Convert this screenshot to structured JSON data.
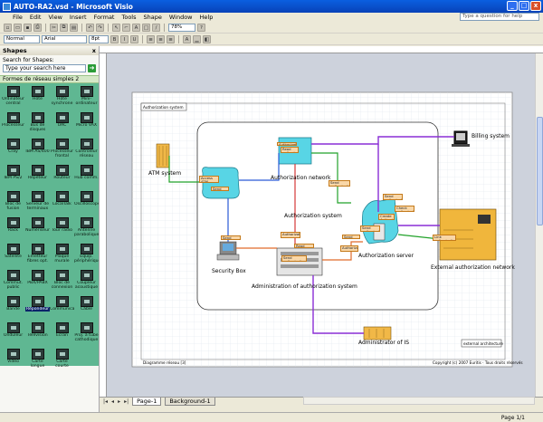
{
  "window": {
    "title": "AUTO-RA2.vsd - Microsoft Visio",
    "buttons": {
      "min": "_",
      "max": "□",
      "close": "x"
    }
  },
  "menu": [
    "File",
    "Edit",
    "View",
    "Insert",
    "Format",
    "Tools",
    "Shape",
    "Window",
    "Help"
  ],
  "help_box": {
    "placeholder": "Type a question for help"
  },
  "toolbar": {
    "zoom": "78%",
    "font": "Arial",
    "size": "8pt",
    "normal": "Normal"
  },
  "shapes_panel": {
    "title": "Shapes",
    "search_label": "Search for Shapes:",
    "search_placeholder": "Type your search here",
    "stencil_title": "Formes de réseau simples 2",
    "items": [
      "Ordinateur central",
      "Hôte",
      "Hôte synchrone",
      "Mini-ordinateur",
      "Processeur",
      "Bus de disques",
      "UAC",
      "Micro VAX",
      "Cray",
      "IBM AS/400",
      "Processeur frontal",
      "Contrôleur réseau",
      "IBM PS/2",
      "Répéteur",
      "Routeur",
      "Hub comm.",
      "Bloc de fusion",
      "Serveur de terminaux",
      "LocalTalk",
      "Oscilloscope",
      "Rack",
      "Numériseur",
      "Tour radio",
      "Antenne parabolique",
      "Satellite",
      "Emetteur fibres opt.",
      "Plaque murale",
      "Equip. périphérique",
      "Commut. public",
      "PBX/PABX",
      "Bloc de connexion",
      "Coupleur acoustique",
      "Bande",
      "Répondeur",
      "Communicateur",
      "Câble",
      "Onduleur",
      "Télévision",
      "Ecran",
      "Proj. à tube cathodique",
      "Vidéo",
      "Carte longue",
      "Carte courte",
      ""
    ]
  },
  "diagram": {
    "page_title": "Authorization system",
    "labels": {
      "atm": "ATM system",
      "billing": "Billing system",
      "auth_network": "Authorization network",
      "auth_system": "Authorization system",
      "auth_server": "Authorization server",
      "security_box": "Security Box",
      "admin": "Administration of authorization system",
      "ext_network": "External authorization network",
      "admin_is": "Administrator of IS",
      "legend": "external architecture",
      "footer_left": "Diagramme réseau [3]",
      "footer_right": "Copyright (c) 2007 Euritis · Tous droits réservés"
    },
    "boxes": [
      "Access ATM authorization",
      "Send Authorization",
      "Read authorization",
      "Send authorization",
      "Send authorization",
      "Check authorization",
      "Send authorization",
      "Authorization server",
      "Send authorization",
      "Authorization server",
      "Link authorization",
      "Send authorization",
      "Read authorization",
      "Create Authorization",
      "Send Authorization",
      "Authorization request"
    ]
  },
  "tabs": {
    "page1": "Page-1",
    "background": "Background-1"
  },
  "status": {
    "page": "Page 1/1"
  }
}
